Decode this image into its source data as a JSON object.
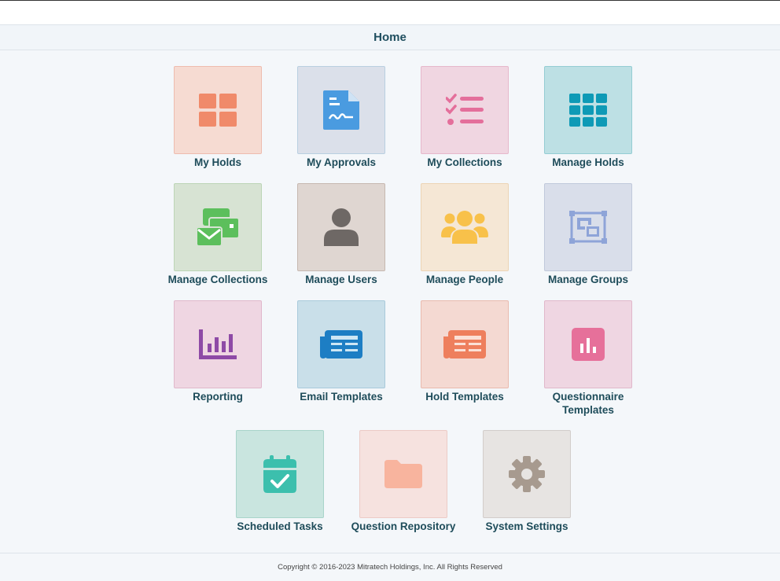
{
  "page": {
    "title": "Home"
  },
  "tiles": [
    {
      "label": "My Holds",
      "icon": "grid-2x2-icon",
      "bg": "#f6dbd2",
      "border": "#eebcae",
      "color": "#f08a6a"
    },
    {
      "label": "My Approvals",
      "icon": "document-signature-icon",
      "bg": "#dbe0ea",
      "border": "#b9cfe0",
      "color": "#4a9be0"
    },
    {
      "label": "My Collections",
      "icon": "checklist-icon",
      "bg": "#f0d6e1",
      "border": "#e6b8cb",
      "color": "#e46f9b"
    },
    {
      "label": "Manage Holds",
      "icon": "grid-3x3-icon",
      "bg": "#bde0e4",
      "border": "#94cdd3",
      "color": "#0e9ab6"
    },
    {
      "label": "Manage Collections",
      "icon": "envelope-cards-icon",
      "bg": "#d7e3d3",
      "border": "#bcd5b6",
      "color": "#5cbf5c"
    },
    {
      "label": "Manage Users",
      "icon": "user-icon",
      "bg": "#dfd6d1",
      "border": "#c6b8b0",
      "color": "#6e6865"
    },
    {
      "label": "Manage People",
      "icon": "people-group-icon",
      "bg": "#f5e7d5",
      "border": "#ecd4b5",
      "color": "#f8c14a"
    },
    {
      "label": "Manage Groups",
      "icon": "object-group-icon",
      "bg": "#d9deea",
      "border": "#c0c9db",
      "color": "#8ea4d8"
    },
    {
      "label": "Reporting",
      "icon": "bar-chart-icon",
      "bg": "#efd6e2",
      "border": "#e0b8cb",
      "color": "#8e4aa6"
    },
    {
      "label": "Email Templates",
      "icon": "newspaper-icon",
      "bg": "#c9dfe9",
      "border": "#a9cadb",
      "color": "#1d7ec4"
    },
    {
      "label": "Hold Templates",
      "icon": "newspaper-icon",
      "bg": "#f4d9d2",
      "border": "#e9baae",
      "color": "#ee7f5d"
    },
    {
      "label": "Questionnaire Templates",
      "icon": "chart-square-icon",
      "bg": "#efd6e2",
      "border": "#e0b8cb",
      "color": "#e6709a"
    },
    {
      "label": "Scheduled Tasks",
      "icon": "calendar-check-icon",
      "bg": "#c9e5df",
      "border": "#a8d4ca",
      "color": "#3cbfad"
    },
    {
      "label": "Question Repository",
      "icon": "folder-icon",
      "bg": "#f6e2df",
      "border": "#eccbc6",
      "color": "#f8b49e"
    },
    {
      "label": "System Settings",
      "icon": "gear-icon",
      "bg": "#e7e4e2",
      "border": "#d2cdca",
      "color": "#a79a8f"
    }
  ],
  "footer": {
    "copyright": "Copyright © 2016-2023 Mitratech Holdings, Inc. All Rights Reserved"
  }
}
